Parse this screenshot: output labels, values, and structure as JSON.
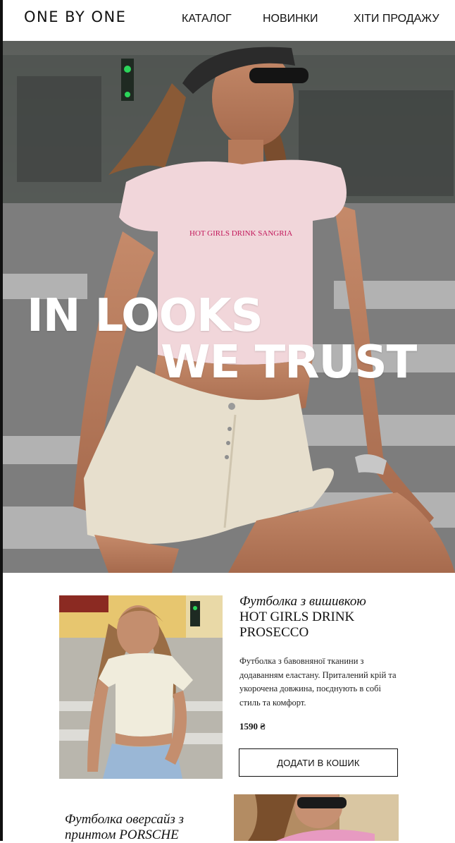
{
  "brand": {
    "logo": "ONE BY ONE"
  },
  "nav": {
    "items": [
      "КАТАЛОГ",
      "НОВИНКИ",
      "ХІТИ ПРОДАЖУ"
    ]
  },
  "hero": {
    "line1": "IN LOOKS",
    "line2": "WE TRUST",
    "shirt_print": "HOT GIRLS DRINK SANGRIA"
  },
  "products": [
    {
      "title_prefix": "Футболка з вишивкою",
      "title_caps": "HOT GIRLS DRINK PROSECCO",
      "description": "Футболка з бавовняної тканини з додаванням еластану. Приталений крій та укорочена довжина, поєднують в собі стиль та комфорт.",
      "price": "1590 ₴",
      "button_label": "ДОДАТИ В КОШИК"
    },
    {
      "title_prefix": "Футболка оверсайз з",
      "title_suffix": "принтом PORSCHE"
    }
  ],
  "colors": {
    "accent": "#c2185b",
    "text": "#111111",
    "background": "#ffffff"
  }
}
